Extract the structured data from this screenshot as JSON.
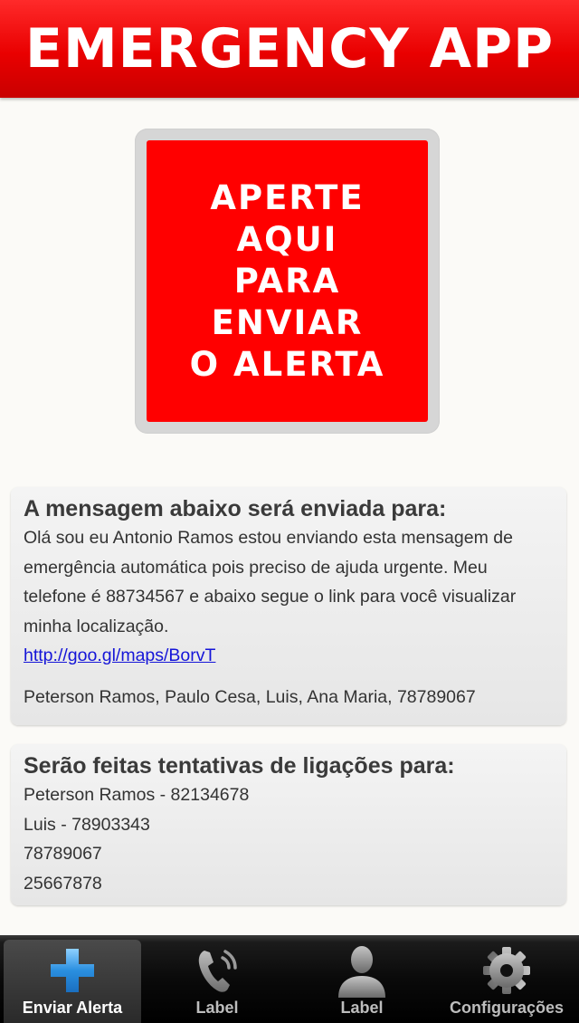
{
  "header": {
    "title": "EMERGENCY APP"
  },
  "alert_button": {
    "label": "APERTE AQUI\nPARA ENVIAR\nO ALERTA"
  },
  "message_panel": {
    "title": "A mensagem abaixo será enviada para:",
    "body": "Olá sou eu Antonio Ramos estou enviando esta mensagem de emergência automática pois preciso de ajuda urgente. Meu telefone é 88734567 e abaixo segue o link para você visualizar minha localização.",
    "link": "http://goo.gl/maps/BorvT",
    "recipients": "Peterson Ramos, Paulo Cesa, Luis, Ana Maria, 78789067"
  },
  "calls_panel": {
    "title": "Serão feitas tentativas de ligações para:",
    "items": [
      "Peterson Ramos - 82134678",
      "Luis - 78903343",
      "78789067",
      "25667878"
    ]
  },
  "tabbar": {
    "tabs": [
      {
        "label": "Enviar Alerta",
        "icon": "plus-icon",
        "active": true
      },
      {
        "label": "Label",
        "icon": "phone-icon",
        "active": false
      },
      {
        "label": "Label",
        "icon": "person-icon",
        "active": false
      },
      {
        "label": "Configurações",
        "icon": "gear-icon",
        "active": false
      }
    ]
  },
  "colors": {
    "header_red": "#e90000",
    "alert_red": "#ff0000",
    "link_blue": "#1515d8",
    "plus_blue": "#2a8fe0"
  }
}
